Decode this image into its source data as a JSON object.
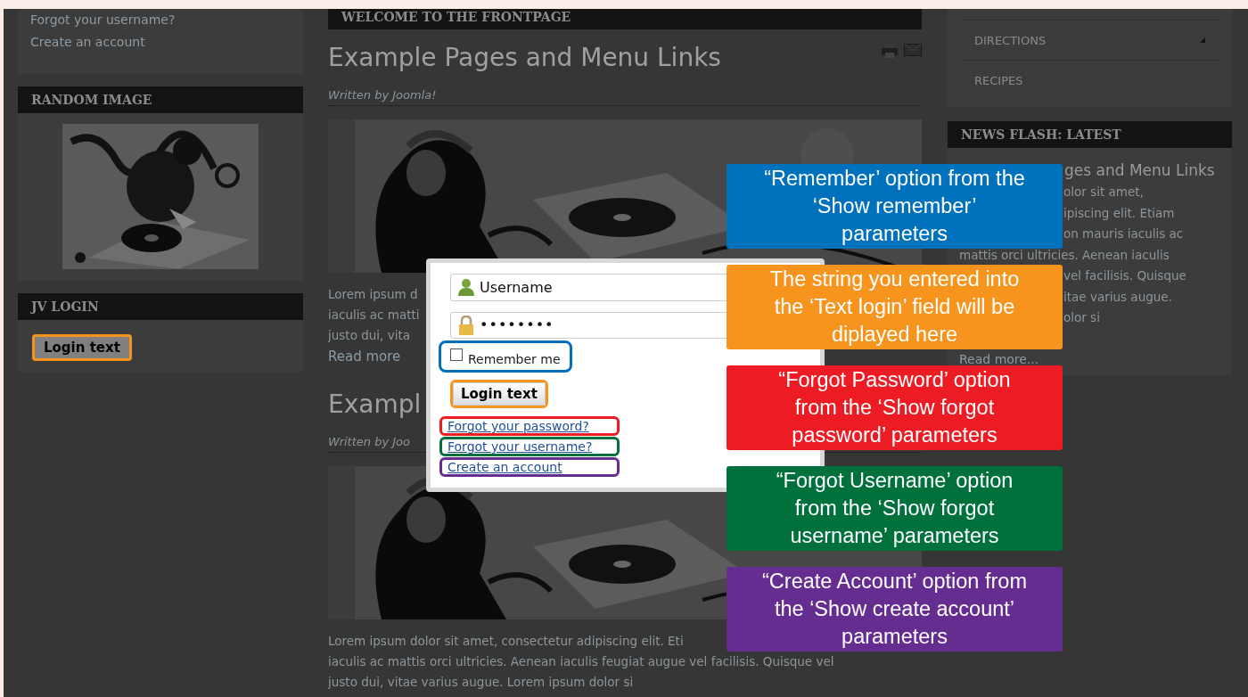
{
  "left": {
    "account_links": [
      "Forgot your username?",
      "Create an account"
    ],
    "random_image": {
      "title": "RANDOM IMAGE"
    },
    "login_module": {
      "title": "JV LOGIN",
      "button": "Login text",
      "color": "#f7941d"
    }
  },
  "center": {
    "section_title": "WELCOME TO THE FRONTPAGE",
    "articles": [
      {
        "title": "Example Pages and Menu Links",
        "author": "Written by Joomla!",
        "show_icons": true,
        "text_lines": [
          "Lorem ipsum d",
          "iaculis ac matti",
          "justo dui, vita"
        ],
        "read_more": "Read more"
      },
      {
        "title": "Exampl",
        "author": "Written by Joo",
        "show_icons": false,
        "text_lines": [
          "Lorem ipsum dolor sit amet, consectetur adipiscing elit. Eti",
          "iaculis ac mattis orci ultricies. Aenean iaculis feugiat augue vel facilisis. Quisque vel",
          "justo dui, vitae varius augue. Lorem ipsum dolor si"
        ]
      }
    ]
  },
  "right": {
    "menu": [
      {
        "label": "DIRECTIONS",
        "has_submenu": true
      },
      {
        "label": "RECIPES",
        "has_submenu": false
      }
    ],
    "news_flash": {
      "title": "NEWS FLASH: LATEST",
      "headline": "ges and Menu Links",
      "text_lines": [
        "olor sit amet,",
        "ipiscing elit. Etiam",
        "on mauris iaculis ac",
        "mattis orci ultricies. Aenean iaculis",
        "vel facilisis. Quisque",
        "itae varius augue.",
        "olor si"
      ],
      "read_more": "Read more..."
    }
  },
  "login_popup": {
    "username": "Username",
    "password": "••••••••",
    "remember": {
      "label": "Remember me",
      "checked": false,
      "color": "#0071bc"
    },
    "button": {
      "label": "Login text",
      "color": "#f7941d"
    },
    "links": [
      {
        "label": "Forgot your password?",
        "color": "#ed1c24"
      },
      {
        "label": "Forgot your username?",
        "color": "#00703c"
      },
      {
        "label": "Create an account",
        "color": "#662d91"
      }
    ]
  },
  "callouts": [
    {
      "text": "“Remember’ option from the\n‘Show remember’\nparameters",
      "color": "#0071bc"
    },
    {
      "text": "The string you entered into\nthe ‘Text login’ field will be\ndiplayed here",
      "color": "#f7941d"
    },
    {
      "text": "“Forgot Password’ option\nfrom the ‘Show forgot\npassword’ parameters",
      "color": "#ed1c24"
    },
    {
      "text": "“Forgot Username’ option\nfrom the ‘Show forgot\nusername’ parameters",
      "color": "#00703c"
    },
    {
      "text": "“Create Account’ option from\nthe ‘Show create account’\nparameters",
      "color": "#662d91"
    }
  ]
}
